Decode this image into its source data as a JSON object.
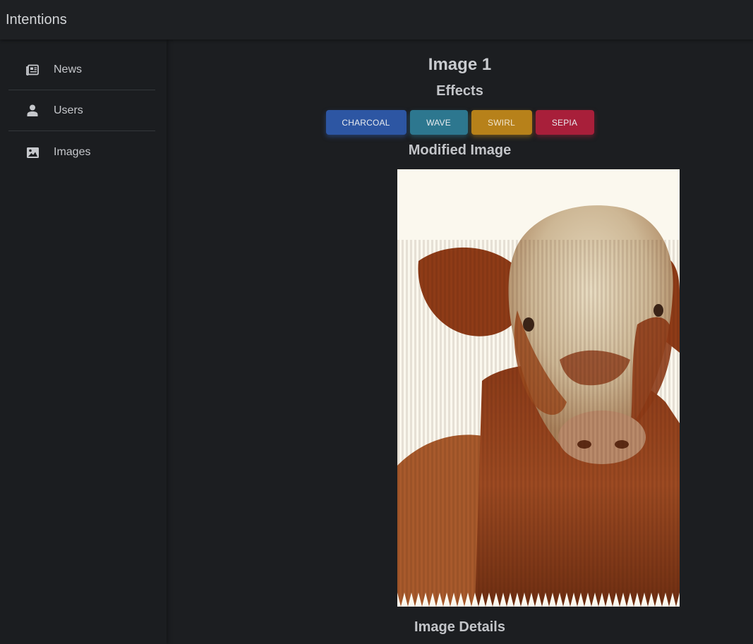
{
  "app": {
    "title": "Intentions"
  },
  "sidebar": {
    "items": [
      {
        "label": "News",
        "icon": "newspaper-icon"
      },
      {
        "label": "Users",
        "icon": "person-icon"
      },
      {
        "label": "Images",
        "icon": "image-icon"
      }
    ]
  },
  "main": {
    "title": "Image 1",
    "effects_heading": "Effects",
    "effects": [
      {
        "label": "CHARCOAL",
        "color": "#2d56a3"
      },
      {
        "label": "WAVE",
        "color": "#2d778f"
      },
      {
        "label": "SWIRL",
        "color": "#b7811a"
      },
      {
        "label": "SEPIA",
        "color": "#a81f3a"
      }
    ],
    "modified_heading": "Modified Image",
    "details_heading": "Image Details"
  },
  "colors": {
    "background": "#1b1d20",
    "topbar": "#1e2023",
    "text": "#c9cbcf"
  }
}
